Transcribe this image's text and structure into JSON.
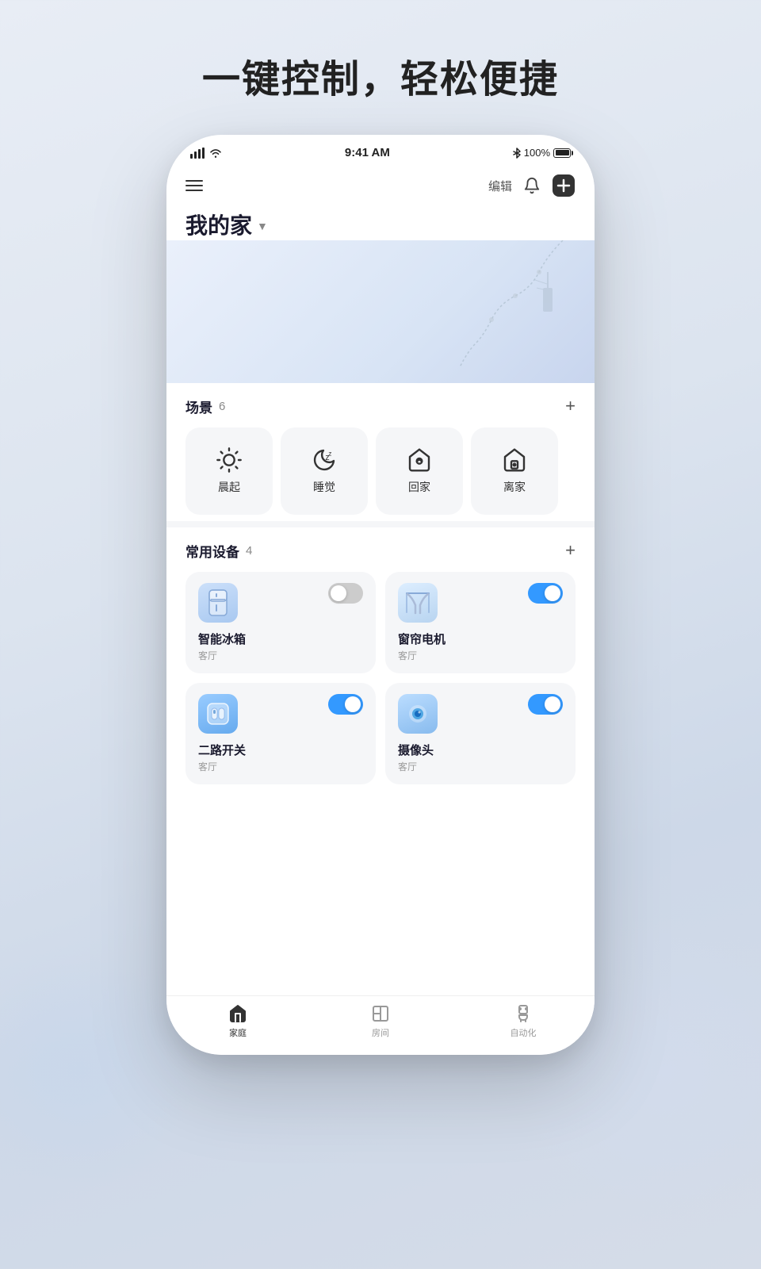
{
  "headline": "一键控制，轻松便捷",
  "statusBar": {
    "time": "9:41 AM",
    "battery": "100%",
    "batteryIcon": "battery-full"
  },
  "topBar": {
    "editLabel": "编辑",
    "menuIcon": "menu-icon",
    "bellIcon": "bell-icon",
    "plusIcon": "plus-circle-icon"
  },
  "homeTitle": "我的家",
  "scenes": {
    "title": "场景",
    "count": "6",
    "addLabel": "+",
    "items": [
      {
        "id": "morning",
        "label": "晨起",
        "icon": "sun"
      },
      {
        "id": "sleep",
        "label": "睡觉",
        "icon": "moon"
      },
      {
        "id": "home",
        "label": "回家",
        "icon": "home-smile"
      },
      {
        "id": "away",
        "label": "离家",
        "icon": "home-lock"
      }
    ]
  },
  "devices": {
    "title": "常用设备",
    "count": "4",
    "addLabel": "+",
    "items": [
      {
        "id": "fridge",
        "name": "智能冰箱",
        "room": "客厅",
        "icon": "fridge",
        "on": false
      },
      {
        "id": "curtain",
        "name": "窗帘电机",
        "room": "客厅",
        "icon": "curtain",
        "on": true
      },
      {
        "id": "switch",
        "name": "二路开关",
        "room": "客厅",
        "icon": "switch",
        "on": true
      },
      {
        "id": "camera",
        "name": "摄像头",
        "room": "客厅",
        "icon": "camera",
        "on": true
      }
    ]
  },
  "bottomNav": {
    "items": [
      {
        "id": "home",
        "label": "家庭",
        "icon": "home",
        "active": true
      },
      {
        "id": "room",
        "label": "房间",
        "icon": "room",
        "active": false
      },
      {
        "id": "automation",
        "label": "自动化",
        "icon": "robot",
        "active": false
      }
    ]
  }
}
